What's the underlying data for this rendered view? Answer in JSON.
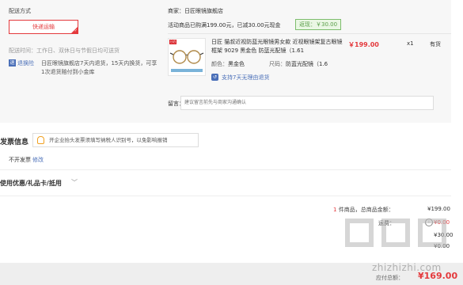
{
  "shipping": {
    "label": "配送方式",
    "method_button": "快递运输",
    "delivery_time": "配送时间：工作日、双休日与节假日均可送货",
    "return_tag": "退",
    "return_link": "退换险",
    "return_desc": "日匠眼镜旗舰店7天内退货，15天内换货，可享1次退货赔付到小金库"
  },
  "shop": {
    "name": "商家：日匠眼镜旗舰店",
    "promo_text": "活动商品已购满199.00元，已减30.00元现金",
    "promo_badge": "返现：￥30.00"
  },
  "product": {
    "logo": "日匠",
    "title": "日匠 猫叔近视防蓝光眼镜男女款 近视眼镜架复古眼镜框架 9029 黑金色 防蓝光配镜（1.61",
    "color_label": "颜色：",
    "color_value": "黑金色",
    "lens_label": "尺码：",
    "lens_value": "防蓝光配镜（1.6",
    "return_support": "支持7天无理由退货",
    "price": "￥199.00",
    "qty": "x1",
    "stock": "有货"
  },
  "note": {
    "label": "留言：",
    "placeholder": "建议留言前先与商家沟通确认"
  },
  "invoice": {
    "title": "发票信息",
    "tip": "开企业抬头发票须填写纳税人识别号，以免影响报销",
    "type": "不开发票",
    "modify": "修改"
  },
  "coupon": {
    "title": "使用优惠/礼品卡/抵用",
    "chevron": "﹀"
  },
  "summary": {
    "count_num": "1",
    "count_text": " 件商品，总商品金额：",
    "goods_amount": "¥199.00",
    "ship_fee_label": "运费：",
    "ship_fee_icon": "i",
    "ship_fee_value": "¥0.00",
    "row3_value": "¥30.00",
    "row4_value": "¥0.00",
    "pay_label": "应付总额：",
    "pay_amount": "¥169.00"
  },
  "watermark": "zhizhizhi.com",
  "colors": {
    "accent": "#e4393c",
    "link": "#4a6fb8",
    "success": "#5a9e4a"
  }
}
